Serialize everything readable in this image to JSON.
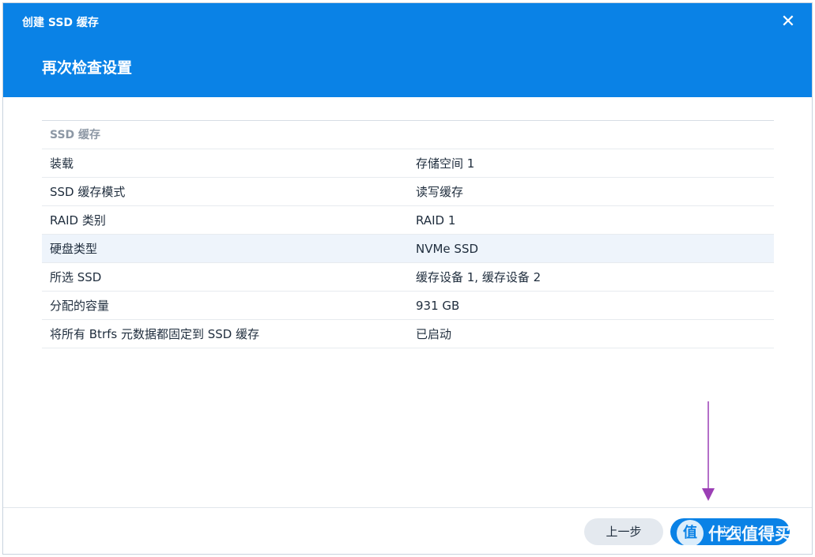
{
  "window": {
    "title": "创建 SSD 缓存",
    "close_icon": "close-icon"
  },
  "step": {
    "title": "再次检查设置"
  },
  "summary": {
    "section_label": "SSD 缓存",
    "rows": [
      {
        "label": "装载",
        "value": "存储空间 1"
      },
      {
        "label": "SSD 缓存模式",
        "value": "读写缓存"
      },
      {
        "label": "RAID 类别",
        "value": "RAID 1"
      },
      {
        "label": "硬盘类型",
        "value": "NVMe SSD"
      },
      {
        "label": "所选 SSD",
        "value": "缓存设备 1, 缓存设备 2"
      },
      {
        "label": "分配的容量",
        "value": "931 GB"
      },
      {
        "label": "将所有 Btrfs 元数据都固定到 SSD 缓存",
        "value": "已启动"
      }
    ]
  },
  "footer": {
    "prev_label": "上一步",
    "done_label": "应用"
  },
  "watermark": {
    "logo": "值",
    "text": "什么值得买"
  },
  "colors": {
    "accent": "#0a82e6",
    "arrow": "#9b3fb5",
    "highlight_row": "#eef4fb"
  }
}
